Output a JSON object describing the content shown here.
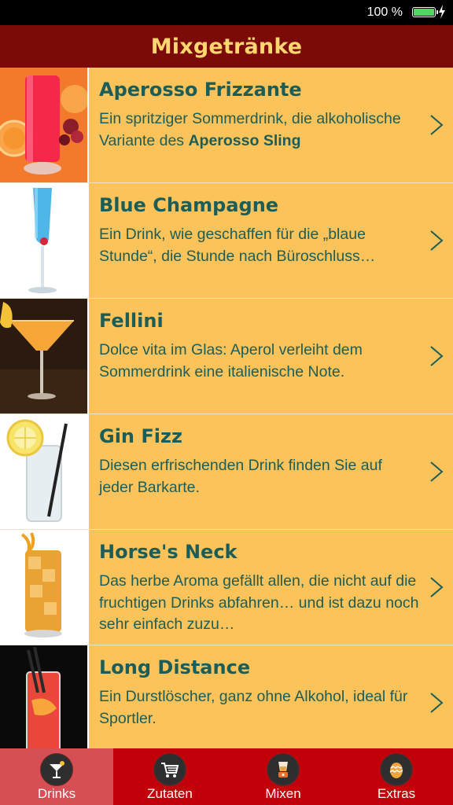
{
  "status": {
    "battery": "100 %"
  },
  "header": {
    "title": "Mixgetränke"
  },
  "drinks": [
    {
      "name": "Aperosso Frizzante",
      "desc": "Ein spritziger Sommerdrink, die alkoholische Variante des ",
      "desc_bold": "Aperosso Sling",
      "desc_after": ""
    },
    {
      "name": "Blue Champagne",
      "desc": "Ein Drink, wie geschaffen für die „blaue Stunde“, die Stunde nach Büroschluss…",
      "desc_bold": "",
      "desc_after": ""
    },
    {
      "name": "Fellini",
      "desc": "Dolce vita im Glas: Aperol verleiht dem Sommerdrink eine italienische Note.",
      "desc_bold": "",
      "desc_after": ""
    },
    {
      "name": "Gin Fizz",
      "desc": "Diesen erfrischenden Drink finden Sie auf jeder Barkarte.",
      "desc_bold": "",
      "desc_after": ""
    },
    {
      "name": "Horse's Neck",
      "desc": "Das herbe Aroma gefällt allen, die nicht auf die fruchtigen Drinks abfahren… und ist dazu noch sehr einfach zuzu…",
      "desc_bold": "",
      "desc_after": ""
    },
    {
      "name": "Long Distance",
      "desc": "Ein Durstlöscher, ganz ohne Alkohol, ideal für Sportler.",
      "desc_bold": "",
      "desc_after": ""
    }
  ],
  "tabs": [
    {
      "label": "Drinks",
      "icon": "cocktail-icon",
      "active": true
    },
    {
      "label": "Zutaten",
      "icon": "shopping-cart-icon",
      "active": false
    },
    {
      "label": "Mixen",
      "icon": "blender-icon",
      "active": false
    },
    {
      "label": "Extras",
      "icon": "egg-icon",
      "active": false
    }
  ],
  "colors": {
    "header_bg": "#7C0A08",
    "header_text": "#FFD76E",
    "row_bg": "#FCC35A",
    "text": "#1C5D58",
    "tabbar_bg": "#C1000A",
    "tab_active_bg": "#D84E55"
  }
}
